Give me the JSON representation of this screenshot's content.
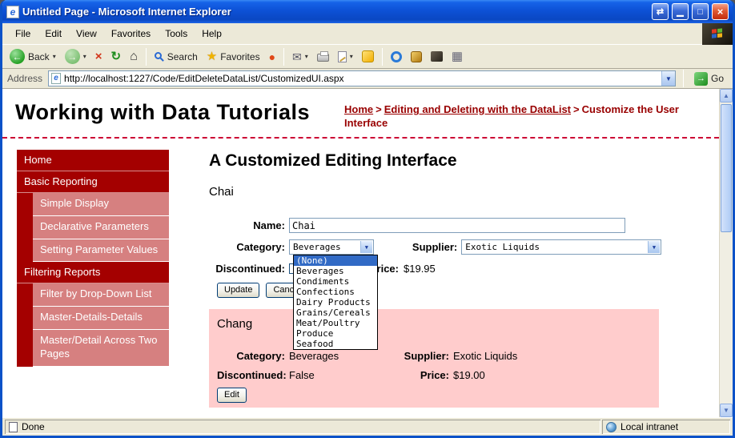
{
  "window": {
    "title": "Untitled Page - Microsoft Internet Explorer",
    "menu": [
      "File",
      "Edit",
      "View",
      "Favorites",
      "Tools",
      "Help"
    ],
    "toolbar": {
      "back": "Back",
      "search": "Search",
      "favorites": "Favorites"
    },
    "address": {
      "label": "Address",
      "url": "http://localhost:1227/Code/EditDeleteDataList/CustomizedUI.aspx",
      "go": "Go"
    },
    "status": {
      "left": "Done",
      "zone": "Local intranet"
    }
  },
  "page": {
    "site_title": "Working with Data Tutorials",
    "breadcrumb": {
      "home": "Home",
      "sep": ">",
      "section": "Editing and Deleting with the DataList",
      "current": "Customize the User Interface"
    },
    "sidebar": [
      "Home",
      "Basic Reporting",
      "Simple Display",
      "Declarative Parameters",
      "Setting Parameter Values",
      "Filtering Reports",
      "Filter by Drop-Down List",
      "Master-Details-Details",
      "Master/Detail Across Two Pages"
    ],
    "heading": "A Customized Editing Interface",
    "edit_item": {
      "name": "Chai",
      "name_label": "Name:",
      "name_value": "Chai",
      "category_label": "Category:",
      "category_value": "Beverages",
      "supplier_label": "Supplier:",
      "supplier_value": "Exotic Liquids",
      "discontinued_label": "Discontinued:",
      "price_label": "Price:",
      "price_value": "$19.95",
      "update_label": "Update",
      "cancel_label": "Cancel",
      "options": [
        "(None)",
        "Beverages",
        "Condiments",
        "Confections",
        "Dairy Products",
        "Grains/Cereals",
        "Meat/Poultry",
        "Produce",
        "Seafood"
      ]
    },
    "view_item": {
      "name": "Chang",
      "category_label": "Category:",
      "category_value": "Beverages",
      "supplier_label": "Supplier:",
      "supplier_value": "Exotic Liquids",
      "discontinued_label": "Discontinued:",
      "discontinued_value": "False",
      "price_label": "Price:",
      "price_value": "$19.00",
      "edit_label": "Edit"
    }
  },
  "icons": {
    "arrows": "⇄",
    "minimize": "▁",
    "maximize": "□",
    "close": "×",
    "back": "←",
    "forward": "→",
    "stop": "×",
    "refresh": "↻",
    "home": "⌂",
    "star": "★",
    "media": "●",
    "mail": "✉",
    "grid": "▦",
    "caret": "▾",
    "dropdown": "▼",
    "go": "→",
    "up": "▲",
    "down": "▼"
  }
}
